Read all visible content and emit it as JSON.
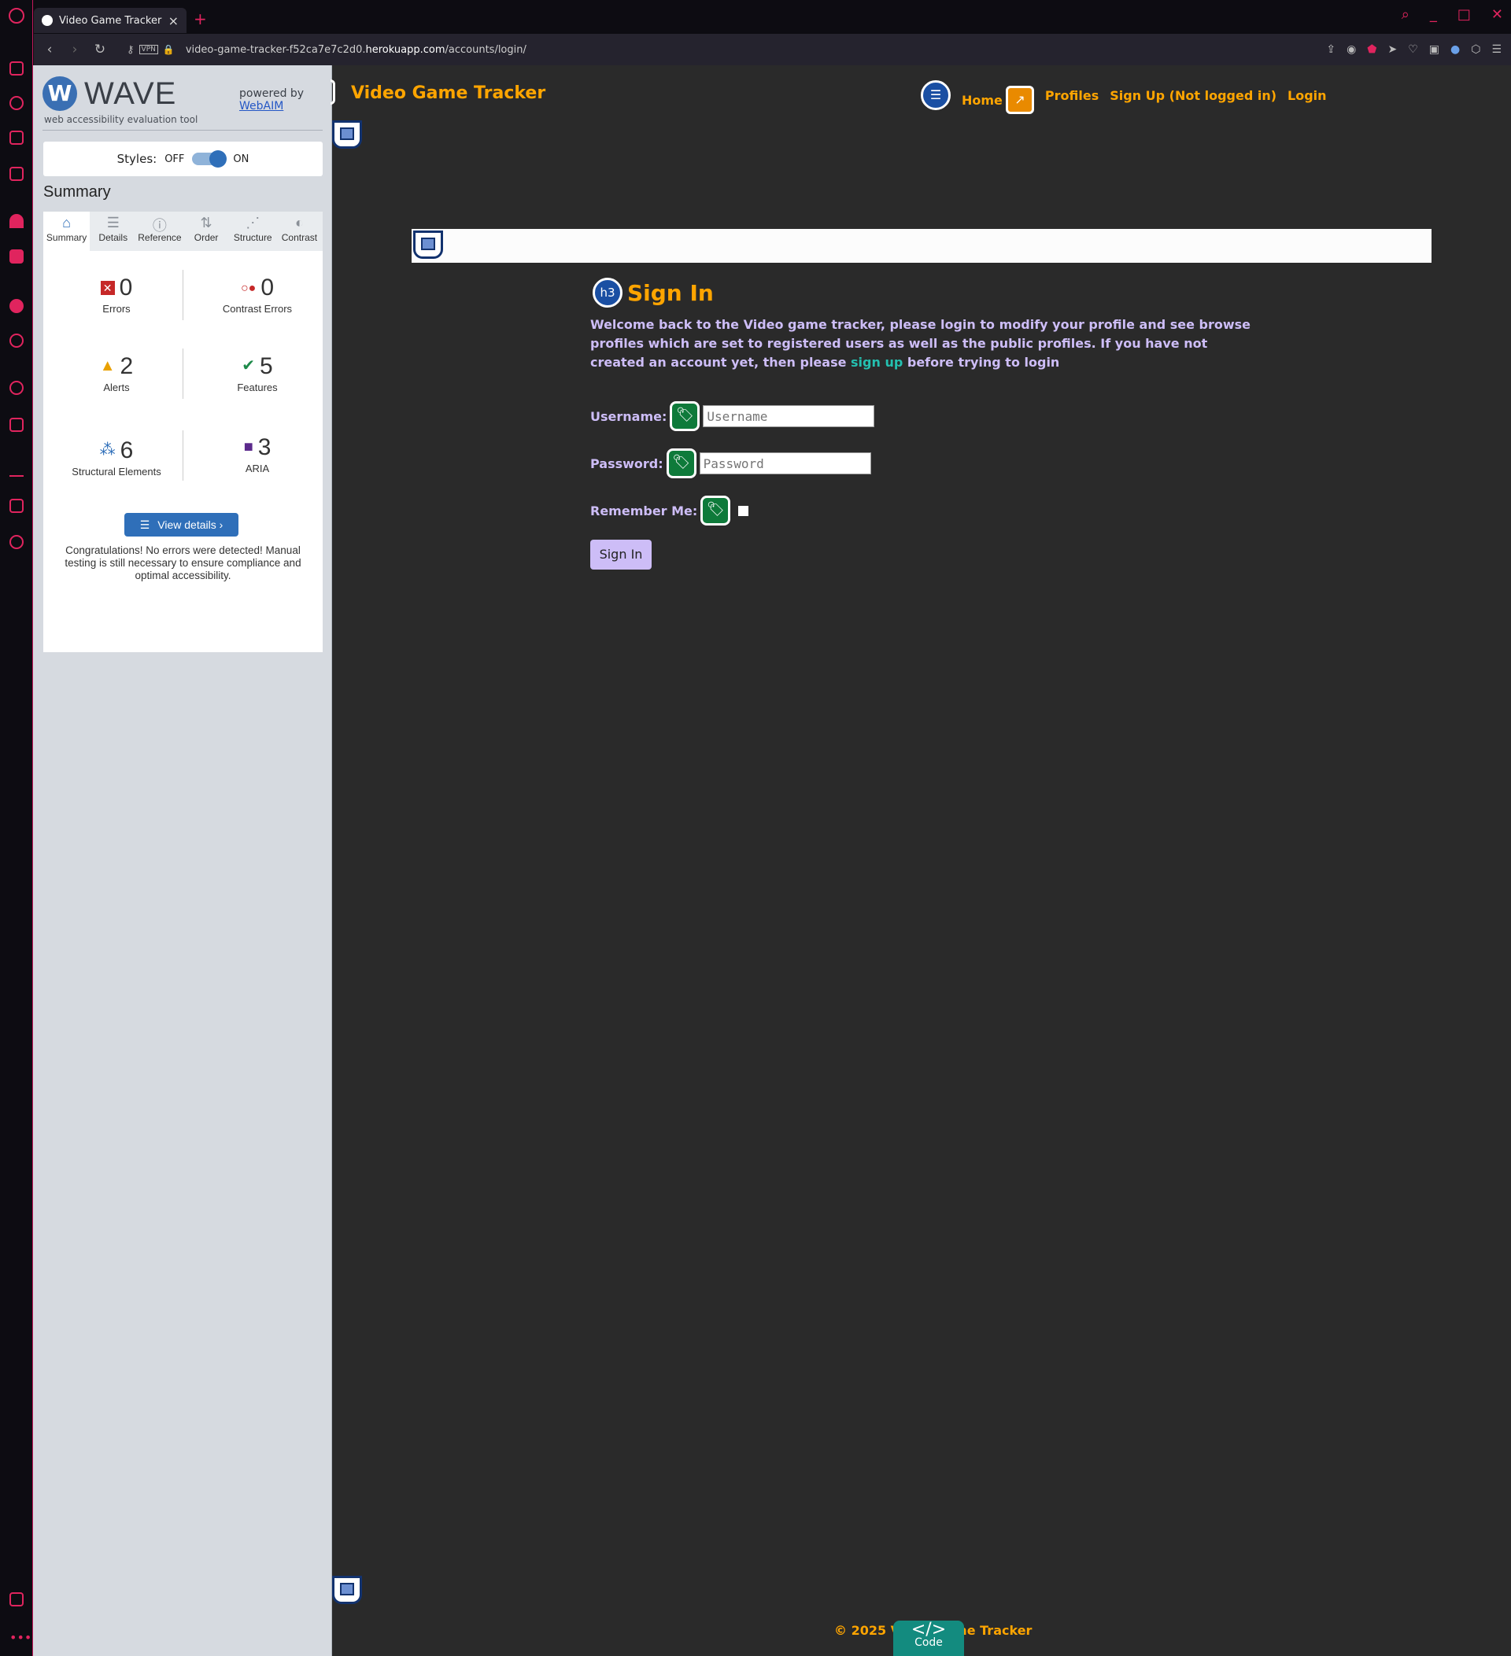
{
  "browser": {
    "tab_title": "Video Game Tracker",
    "url_prefix": "video-game-tracker-f52ca7e7c2d0.",
    "url_domain": "herokuapp.com",
    "url_path": "/accounts/login/",
    "vpn_label": "VPN"
  },
  "wave": {
    "logo_letter": "W",
    "title": "WAVE",
    "subtitle": "web accessibility evaluation tool",
    "powered_by": "powered by",
    "webaim": "WebAIM",
    "styles_label": "Styles:",
    "off_label": "OFF",
    "on_label": "ON",
    "summary_heading": "Summary",
    "tabs": [
      {
        "label": "Summary",
        "icon": "⌂"
      },
      {
        "label": "Details",
        "icon": "☰"
      },
      {
        "label": "Reference",
        "icon": "ⓘ"
      },
      {
        "label": "Order",
        "icon": "⇅"
      },
      {
        "label": "Structure",
        "icon": "⋰"
      },
      {
        "label": "Contrast",
        "icon": "◐"
      }
    ],
    "stats": {
      "errors": {
        "count": "0",
        "label": "Errors"
      },
      "contrast_errors": {
        "count": "0",
        "label": "Contrast Errors"
      },
      "alerts": {
        "count": "2",
        "label": "Alerts"
      },
      "features": {
        "count": "5",
        "label": "Features"
      },
      "structural": {
        "count": "6",
        "label": "Structural Elements"
      },
      "aria": {
        "count": "3",
        "label": "ARIA"
      }
    },
    "view_details": "View details ›",
    "congrats": "Congratulations! No errors were detected! Manual testing is still necessary to ensure compliance and optimal accessibility."
  },
  "site": {
    "brand": "Video Game Tracker",
    "nav": {
      "home": "Home",
      "profiles": "Profiles",
      "signup": "Sign Up (Not logged in)",
      "login": "Login"
    },
    "h3_badge": "h3",
    "heading": "Sign In",
    "welcome_before": "Welcome back to the Video game tracker, please login to modify your profile and see browse profiles which are set to registered users as well as the public profiles. If you have not created an account yet, then please ",
    "welcome_link": "sign up",
    "welcome_after": " before trying to login",
    "username_label": "Username:",
    "username_placeholder": "Username",
    "password_label": "Password:",
    "password_placeholder": "Password",
    "remember_label": "Remember Me:",
    "signin_button": "Sign In",
    "footer": "© 2025 Video Game Tracker",
    "code_badge_symbol": "</>",
    "code_badge_label": "Code"
  }
}
